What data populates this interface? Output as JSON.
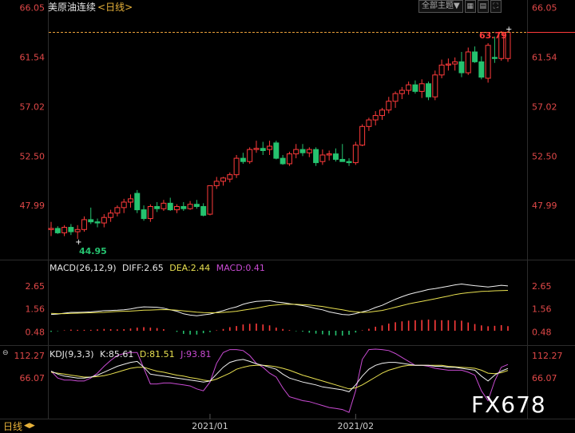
{
  "header": {
    "title": "美原油连续",
    "period": "<日线>",
    "theme_button": "全部主题",
    "theme_arrow": "▼"
  },
  "footer": {
    "period_label": "日线",
    "period_arrow": "◀▶"
  },
  "watermark": "FX678",
  "chart_data": [
    {
      "type": "candlestick",
      "title": "美原油连续 <日线>",
      "ylim": [
        44.0,
        66.3
      ],
      "y_ticks": [
        "66.05",
        "61.54",
        "57.02",
        "52.50",
        "47.99"
      ],
      "x_ticks": [
        "2021/01",
        "2021/02"
      ],
      "last_price": "63.79",
      "low_marker": "44.95",
      "colors": {
        "up": "#ff3b3b",
        "down": "#25c26f",
        "axis_text": "#e04848",
        "dashed": "#e8a03a"
      },
      "candles": [
        [
          45.8,
          46.5,
          45.2,
          45.9
        ],
        [
          45.9,
          46.1,
          45.4,
          45.5
        ],
        [
          45.5,
          46.2,
          45.2,
          46.0
        ],
        [
          46.0,
          46.3,
          45.3,
          45.6
        ],
        [
          45.6,
          46.2,
          44.95,
          45.8
        ],
        [
          45.8,
          47.0,
          45.6,
          46.7
        ],
        [
          46.7,
          47.8,
          46.3,
          46.5
        ],
        [
          46.5,
          46.8,
          46.0,
          46.4
        ],
        [
          46.4,
          47.2,
          46.0,
          46.9
        ],
        [
          46.9,
          47.6,
          46.5,
          47.3
        ],
        [
          47.3,
          48.0,
          47.0,
          47.8
        ],
        [
          47.8,
          48.6,
          47.3,
          48.3
        ],
        [
          48.3,
          49.0,
          47.8,
          48.6
        ],
        [
          49.1,
          49.4,
          47.3,
          47.6
        ],
        [
          47.6,
          48.0,
          46.6,
          46.8
        ],
        [
          46.8,
          48.1,
          46.5,
          47.9
        ],
        [
          47.9,
          48.3,
          47.4,
          47.7
        ],
        [
          47.7,
          48.5,
          47.5,
          48.2
        ],
        [
          48.2,
          48.7,
          47.5,
          47.6
        ],
        [
          47.6,
          48.1,
          47.3,
          47.9
        ],
        [
          47.9,
          48.3,
          47.5,
          47.7
        ],
        [
          47.7,
          48.4,
          47.6,
          48.1
        ],
        [
          48.1,
          48.5,
          47.7,
          47.9
        ],
        [
          47.9,
          48.2,
          47.0,
          47.1
        ],
        [
          47.2,
          49.8,
          47.1,
          49.8
        ],
        [
          49.8,
          50.6,
          49.5,
          50.2
        ],
        [
          50.2,
          50.6,
          49.8,
          50.5
        ],
        [
          50.4,
          51.0,
          50.1,
          50.8
        ],
        [
          50.8,
          52.6,
          50.5,
          52.3
        ],
        [
          52.3,
          52.8,
          51.8,
          52.0
        ],
        [
          52.0,
          53.3,
          51.8,
          53.1
        ],
        [
          53.1,
          53.9,
          52.8,
          53.2
        ],
        [
          53.2,
          53.8,
          52.6,
          53.0
        ],
        [
          53.1,
          53.9,
          52.6,
          53.4
        ],
        [
          53.7,
          53.9,
          52.2,
          52.3
        ],
        [
          52.3,
          52.6,
          51.7,
          51.8
        ],
        [
          51.8,
          52.9,
          51.6,
          52.7
        ],
        [
          52.7,
          53.6,
          52.3,
          53.1
        ],
        [
          53.1,
          53.6,
          52.5,
          52.8
        ],
        [
          52.8,
          53.3,
          52.4,
          53.1
        ],
        [
          53.1,
          53.3,
          51.6,
          51.9
        ],
        [
          52.0,
          53.1,
          51.7,
          52.6
        ],
        [
          52.6,
          53.0,
          52.1,
          52.7
        ],
        [
          52.7,
          53.2,
          52.0,
          52.2
        ],
        [
          52.2,
          53.6,
          52.0,
          52.0
        ],
        [
          52.0,
          52.3,
          51.6,
          51.9
        ],
        [
          51.9,
          53.8,
          51.7,
          53.5
        ],
        [
          53.5,
          55.4,
          53.4,
          55.2
        ],
        [
          55.2,
          56.0,
          54.8,
          55.8
        ],
        [
          55.8,
          56.6,
          55.3,
          56.2
        ],
        [
          56.2,
          56.9,
          55.8,
          56.7
        ],
        [
          56.7,
          57.9,
          56.4,
          57.5
        ],
        [
          57.5,
          58.4,
          56.9,
          58.2
        ],
        [
          58.2,
          58.8,
          57.7,
          58.5
        ],
        [
          58.5,
          59.3,
          58.1,
          59.0
        ],
        [
          59.0,
          59.4,
          58.2,
          58.4
        ],
        [
          58.4,
          59.5,
          57.8,
          59.1
        ],
        [
          59.1,
          59.3,
          57.6,
          57.9
        ],
        [
          57.9,
          60.3,
          57.6,
          59.9
        ],
        [
          59.9,
          61.3,
          59.6,
          60.8
        ],
        [
          60.8,
          61.4,
          60.3,
          60.9
        ],
        [
          60.9,
          61.5,
          60.3,
          61.1
        ],
        [
          61.1,
          62.0,
          59.7,
          60.1
        ],
        [
          60.1,
          62.4,
          59.9,
          62.0
        ],
        [
          62.0,
          62.5,
          61.0,
          61.1
        ],
        [
          61.1,
          61.6,
          59.5,
          59.7
        ],
        [
          59.6,
          62.8,
          59.2,
          62.6
        ],
        [
          61.5,
          63.4,
          61.0,
          61.4
        ],
        [
          61.4,
          63.9,
          61.2,
          63.8
        ],
        [
          61.4,
          63.9,
          61.1,
          63.79
        ]
      ]
    },
    {
      "type": "macd",
      "label": "MACD(26,12,9)",
      "diff_label": "DIFF:2.65",
      "dea_label": "DEA:2.44",
      "macd_label": "MACD:0.41",
      "y_ticks": [
        "2.65",
        "1.56",
        "0.48"
      ],
      "ylim": [
        0.0,
        3.1
      ],
      "colors": {
        "diff": "#f0f0f0",
        "dea": "#e8e050",
        "macd": "#c94bd3",
        "pos": "#ff3b3b",
        "neg": "#25c26f"
      },
      "diff": [
        1.3,
        1.32,
        1.36,
        1.4,
        1.4,
        1.41,
        1.42,
        1.45,
        1.48,
        1.49,
        1.5,
        1.52,
        1.56,
        1.62,
        1.66,
        1.65,
        1.64,
        1.6,
        1.52,
        1.45,
        1.33,
        1.27,
        1.24,
        1.28,
        1.32,
        1.4,
        1.48,
        1.58,
        1.66,
        1.78,
        1.86,
        1.92,
        1.94,
        1.96,
        1.89,
        1.86,
        1.81,
        1.76,
        1.72,
        1.66,
        1.58,
        1.52,
        1.42,
        1.36,
        1.3,
        1.28,
        1.34,
        1.42,
        1.5,
        1.63,
        1.73,
        1.88,
        2.02,
        2.14,
        2.25,
        2.33,
        2.4,
        2.48,
        2.52,
        2.58,
        2.64,
        2.7,
        2.74,
        2.7,
        2.66,
        2.63,
        2.6,
        2.64,
        2.68,
        2.65
      ],
      "dea": [
        1.35,
        1.34,
        1.34,
        1.35,
        1.36,
        1.37,
        1.38,
        1.39,
        1.4,
        1.42,
        1.44,
        1.45,
        1.46,
        1.48,
        1.5,
        1.51,
        1.52,
        1.53,
        1.52,
        1.5,
        1.47,
        1.44,
        1.41,
        1.39,
        1.38,
        1.38,
        1.4,
        1.42,
        1.45,
        1.5,
        1.55,
        1.6,
        1.66,
        1.72,
        1.75,
        1.78,
        1.78,
        1.78,
        1.76,
        1.75,
        1.71,
        1.68,
        1.62,
        1.57,
        1.52,
        1.46,
        1.42,
        1.4,
        1.41,
        1.45,
        1.49,
        1.56,
        1.64,
        1.72,
        1.8,
        1.86,
        1.92,
        1.98,
        2.04,
        2.11,
        2.17,
        2.24,
        2.29,
        2.33,
        2.36,
        2.39,
        2.4,
        2.42,
        2.43,
        2.44
      ],
      "macd": [
        -0.1,
        -0.04,
        0.04,
        0.1,
        0.08,
        0.08,
        0.08,
        0.12,
        0.16,
        0.14,
        0.12,
        0.14,
        0.2,
        0.28,
        0.32,
        0.28,
        0.24,
        0.14,
        0.0,
        -0.1,
        -0.28,
        -0.34,
        -0.34,
        -0.22,
        -0.12,
        0.04,
        0.16,
        0.32,
        0.42,
        0.56,
        0.62,
        0.64,
        0.56,
        0.48,
        0.28,
        0.16,
        0.06,
        -0.04,
        -0.08,
        -0.18,
        -0.26,
        -0.32,
        -0.4,
        -0.42,
        -0.44,
        -0.36,
        -0.16,
        0.04,
        0.18,
        0.36,
        0.48,
        0.64,
        0.76,
        0.84,
        0.9,
        0.94,
        0.96,
        1.0,
        0.96,
        0.94,
        0.94,
        0.92,
        0.9,
        0.74,
        0.6,
        0.48,
        0.4,
        0.44,
        0.5,
        0.41
      ]
    },
    {
      "type": "kdj",
      "label": "KDJ(9,3,3)",
      "k_label": "K:85.61",
      "d_label": "D:81.51",
      "j_label": "J:93.81",
      "y_ticks": [
        "112.27",
        "66.07"
      ],
      "ylim": [
        -15,
        125
      ],
      "colors": {
        "k": "#f0f0f0",
        "d": "#e8e050",
        "j": "#c94bd3"
      },
      "k": [
        80,
        74,
        70,
        68,
        66,
        66,
        68,
        72,
        78,
        84,
        90,
        94,
        98,
        100,
        88,
        74,
        72,
        70,
        68,
        66,
        64,
        62,
        60,
        58,
        60,
        74,
        88,
        98,
        102,
        104,
        100,
        95,
        92,
        88,
        84,
        74,
        66,
        62,
        58,
        55,
        52,
        48,
        46,
        44,
        42,
        38,
        52,
        70,
        84,
        92,
        96,
        98,
        98,
        96,
        94,
        92,
        92,
        92,
        90,
        90,
        88,
        88,
        86,
        84,
        82,
        70,
        60,
        72,
        80,
        85.61
      ],
      "d": [
        78,
        76,
        74,
        72,
        70,
        68,
        68,
        69,
        71,
        74,
        78,
        82,
        86,
        88,
        88,
        84,
        80,
        78,
        75,
        72,
        70,
        67,
        65,
        62,
        60,
        64,
        70,
        76,
        84,
        88,
        91,
        92,
        92,
        91,
        89,
        86,
        82,
        77,
        72,
        68,
        64,
        60,
        56,
        52,
        48,
        44,
        46,
        52,
        60,
        68,
        76,
        82,
        86,
        90,
        92,
        92,
        92,
        92,
        92,
        92,
        90,
        89,
        88,
        87,
        86,
        82,
        76,
        75,
        77,
        81.51
      ],
      "j": [
        80,
        66,
        62,
        62,
        60,
        60,
        66,
        76,
        90,
        102,
        112,
        116,
        118,
        118,
        86,
        54,
        54,
        56,
        56,
        54,
        52,
        50,
        44,
        40,
        58,
        96,
        118,
        124,
        124,
        122,
        112,
        96,
        88,
        76,
        68,
        46,
        28,
        24,
        20,
        18,
        14,
        10,
        6,
        4,
        2,
        -4,
        40,
        104,
        124,
        125,
        124,
        122,
        116,
        108,
        100,
        92,
        92,
        90,
        86,
        84,
        82,
        82,
        82,
        78,
        72,
        40,
        20,
        60,
        88,
        93.81
      ]
    }
  ]
}
